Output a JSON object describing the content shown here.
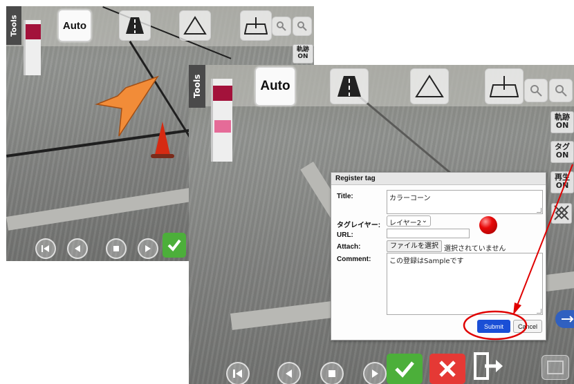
{
  "colors": {
    "accent": "#e8832e",
    "submit": "#1a4fd6",
    "highlight": "#e00000",
    "approve": "#4caf3a",
    "reject": "#e53935"
  },
  "screenshot_back": {
    "tools_label": "Tools",
    "toolbar": {
      "auto_label": "Auto",
      "road_icon": "road-icon",
      "triangle_icon": "triangle-icon",
      "trapezoid_icon": "trapezoid-crosshair-icon"
    },
    "side": {
      "track_label": "軌跡",
      "track_state": "ON"
    },
    "controls": [
      "skip-back-icon",
      "rewind-icon",
      "stop-icon",
      "forward-icon"
    ]
  },
  "screenshot_front": {
    "tools_label": "Tools",
    "toolbar": {
      "auto_label": "Auto"
    },
    "side": [
      {
        "label": "軌跡",
        "state": "ON"
      },
      {
        "label": "タグ",
        "state": "ON"
      },
      {
        "label": "再生",
        "state": "ON"
      }
    ],
    "controls": [
      "skip-back-icon",
      "rewind-icon",
      "stop-icon",
      "forward-icon"
    ],
    "action_tiles": [
      "approve-icon",
      "reject-icon",
      "exit-icon"
    ]
  },
  "dialog": {
    "title": "Register tag",
    "title_label": "Title:",
    "title_value": "カラーコーン",
    "layer_label": "タグレイヤー:",
    "layer_value": "レイヤー2",
    "url_label": "URL:",
    "url_value": "",
    "attach_label": "Attach:",
    "file_button": "ファイルを選択",
    "file_status": "選択されていません",
    "comment_label": "Comment:",
    "comment_value": "この登録はSampleです",
    "submit_label": "Submit",
    "cancel_label": "Cancel"
  }
}
